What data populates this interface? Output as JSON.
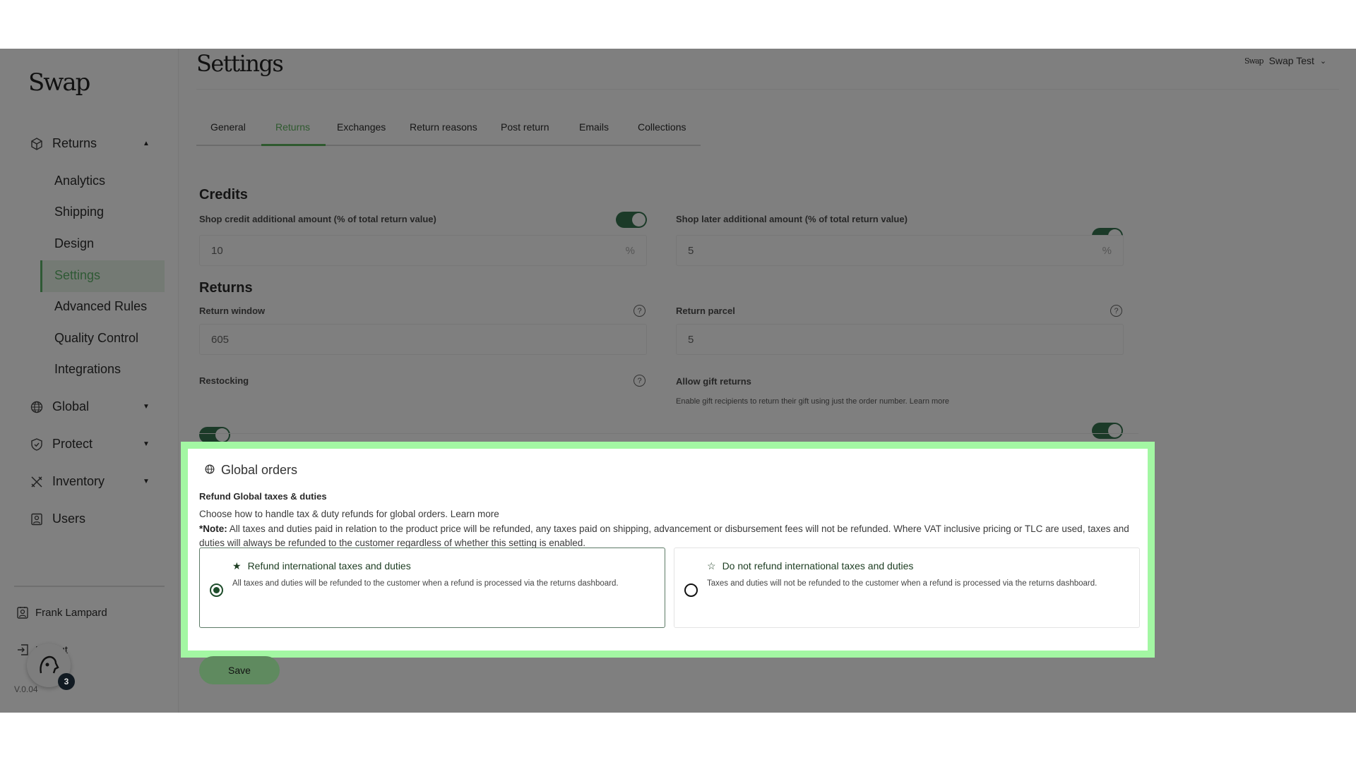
{
  "brand": {
    "logo": "Swap"
  },
  "sidebar": {
    "returns": {
      "label": "Returns",
      "items": [
        "Analytics",
        "Shipping",
        "Design",
        "Settings",
        "Advanced Rules",
        "Quality Control",
        "Integrations"
      ],
      "active": "Settings"
    },
    "sections": [
      {
        "label": "Global",
        "icon": "globe-icon"
      },
      {
        "label": "Protect",
        "icon": "shield-icon"
      },
      {
        "label": "Inventory",
        "icon": "tools-icon"
      },
      {
        "label": "Users",
        "icon": "user-icon"
      }
    ],
    "user": "Frank Lampard",
    "logout": "Logout",
    "version": "V.0.04",
    "notification_count": "3"
  },
  "header": {
    "title": "Settings",
    "store_logo": "Swap",
    "store_name": "Swap Test"
  },
  "tabs": [
    "General",
    "Returns",
    "Exchanges",
    "Return reasons",
    "Post return",
    "Emails",
    "Collections"
  ],
  "active_tab": "Returns",
  "credits": {
    "heading": "Credits",
    "shop_credit": {
      "label": "Shop credit additional amount (% of total return value)",
      "value": "10",
      "unit": "%",
      "enabled": true
    },
    "shop_later": {
      "label": "Shop later additional amount (% of total return value)",
      "value": "5",
      "unit": "%",
      "enabled": true
    }
  },
  "returns": {
    "heading": "Returns",
    "return_window": {
      "label": "Return window",
      "value": "605"
    },
    "return_parcel": {
      "label": "Return parcel",
      "value": "5"
    },
    "restocking": {
      "label": "Restocking",
      "enabled": true
    },
    "gift_returns": {
      "label": "Allow gift returns",
      "help": "Enable gift recipients to return their gift using just the order number.",
      "link": "Learn more",
      "enabled": true
    }
  },
  "global_orders": {
    "title": "Global orders",
    "subtitle": "Refund Global taxes & duties",
    "description": "Choose how to handle tax & duty refunds for global orders.",
    "link": "Learn more",
    "note_label": "*Note:",
    "note": " All taxes and duties paid in relation to the product price will be refunded, any taxes paid on shipping, advancement or disbursement fees will not be refunded. Where VAT inclusive pricing or TLC are used, taxes and duties will always be refunded to the customer regardless of whether this setting is enabled.",
    "options": [
      {
        "title": "Refund international taxes and duties",
        "text": "All taxes and duties will be refunded to the customer when a refund is processed via the returns dashboard.",
        "selected": true
      },
      {
        "title": "Do not refund international taxes and duties",
        "text": "Taxes and duties will not be refunded to the customer when a refund is processed via the returns dashboard.",
        "selected": false
      }
    ]
  },
  "save_label": "Save",
  "colors": {
    "accent": "#1e4d2b",
    "highlight": "#a3f7a3",
    "overlay": "#7f7f7f"
  }
}
